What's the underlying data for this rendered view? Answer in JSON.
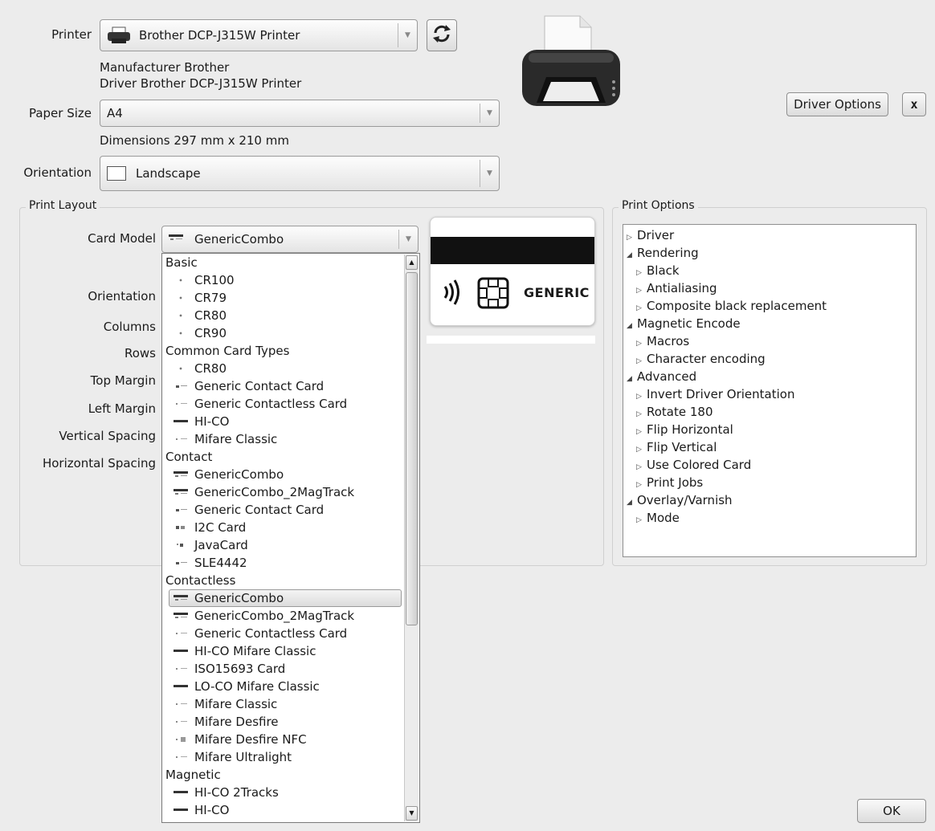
{
  "printer_section": {
    "printer_label": "Printer",
    "printer_value": "Brother DCP-J315W Printer",
    "manufacturer_line": "Manufacturer Brother",
    "driver_line": "Driver Brother DCP-J315W Printer",
    "paper_size_label": "Paper Size",
    "paper_size_value": "A4",
    "dimensions_line": "Dimensions 297 mm x 210 mm",
    "orientation_label": "Orientation",
    "orientation_value": "Landscape",
    "driver_options_label": "Driver Options",
    "close_label": "x"
  },
  "print_layout": {
    "title": "Print Layout",
    "card_model_label": "Card Model",
    "card_model_value": "GenericCombo",
    "orientation_label": "Orientation",
    "columns_label": "Columns",
    "rows_label": "Rows",
    "top_margin_label": "Top Margin",
    "left_margin_label": "Left Margin",
    "vertical_spacing_label": "Vertical Spacing",
    "horizontal_spacing_label": "Horizontal Spacing",
    "card_preview_text": "GENERIC"
  },
  "card_model_dropdown": {
    "groups": [
      {
        "header": "Basic",
        "items": [
          {
            "label": "CR100",
            "icon": "chip"
          },
          {
            "label": "CR79",
            "icon": "chip"
          },
          {
            "label": "CR80",
            "icon": "chip"
          },
          {
            "label": "CR90",
            "icon": "chip"
          }
        ]
      },
      {
        "header": "Common Card Types",
        "items": [
          {
            "label": "CR80",
            "icon": "chip"
          },
          {
            "label": "Generic Contact Card",
            "icon": "contact"
          },
          {
            "label": "Generic Contactless Card",
            "icon": "contactless"
          },
          {
            "label": "HI-CO",
            "icon": "hico"
          },
          {
            "label": "Mifare Classic",
            "icon": "contactless"
          }
        ]
      },
      {
        "header": "Contact",
        "items": [
          {
            "label": "GenericCombo",
            "icon": "combo"
          },
          {
            "label": "GenericCombo_2MagTrack",
            "icon": "combo"
          },
          {
            "label": "Generic Contact Card",
            "icon": "contact"
          },
          {
            "label": "I2C Card",
            "icon": "i2c"
          },
          {
            "label": "JavaCard",
            "icon": "java"
          },
          {
            "label": "SLE4442",
            "icon": "contact"
          }
        ]
      },
      {
        "header": "Contactless",
        "items": [
          {
            "label": "GenericCombo",
            "icon": "combo",
            "selected": true
          },
          {
            "label": "GenericCombo_2MagTrack",
            "icon": "combo"
          },
          {
            "label": "Generic Contactless Card",
            "icon": "contactless"
          },
          {
            "label": "HI-CO Mifare Classic",
            "icon": "hico"
          },
          {
            "label": "ISO15693 Card",
            "icon": "contactless"
          },
          {
            "label": "LO-CO Mifare Classic",
            "icon": "hico"
          },
          {
            "label": "Mifare Classic",
            "icon": "contactless"
          },
          {
            "label": "Mifare Desfire",
            "icon": "contactless"
          },
          {
            "label": "Mifare Desfire NFC",
            "icon": "nfc"
          },
          {
            "label": "Mifare Ultralight",
            "icon": "contactless"
          }
        ]
      },
      {
        "header": "Magnetic",
        "items": [
          {
            "label": "HI-CO 2Tracks",
            "icon": "hico"
          },
          {
            "label": "HI-CO",
            "icon": "hico"
          }
        ]
      }
    ]
  },
  "print_options": {
    "title": "Print Options",
    "tree": [
      {
        "label": "Driver",
        "level": 0,
        "expanded": false
      },
      {
        "label": "Rendering",
        "level": 0,
        "expanded": true
      },
      {
        "label": "Black",
        "level": 1,
        "expanded": false
      },
      {
        "label": "Antialiasing",
        "level": 1,
        "expanded": false
      },
      {
        "label": "Composite black replacement",
        "level": 1,
        "expanded": false
      },
      {
        "label": "Magnetic Encode",
        "level": 0,
        "expanded": true
      },
      {
        "label": "Macros",
        "level": 1,
        "expanded": false
      },
      {
        "label": "Character encoding",
        "level": 1,
        "expanded": false
      },
      {
        "label": "Advanced",
        "level": 0,
        "expanded": true
      },
      {
        "label": "Invert Driver Orientation",
        "level": 1,
        "expanded": false
      },
      {
        "label": "Rotate 180",
        "level": 1,
        "expanded": false
      },
      {
        "label": "Flip Horizontal",
        "level": 1,
        "expanded": false
      },
      {
        "label": "Flip Vertical",
        "level": 1,
        "expanded": false
      },
      {
        "label": "Use Colored Card",
        "level": 1,
        "expanded": false
      },
      {
        "label": "Print Jobs",
        "level": 1,
        "expanded": false
      },
      {
        "label": "Overlay/Varnish",
        "level": 0,
        "expanded": true
      },
      {
        "label": "Mode",
        "level": 1,
        "expanded": false
      }
    ]
  },
  "footer": {
    "ok_label": "OK"
  }
}
